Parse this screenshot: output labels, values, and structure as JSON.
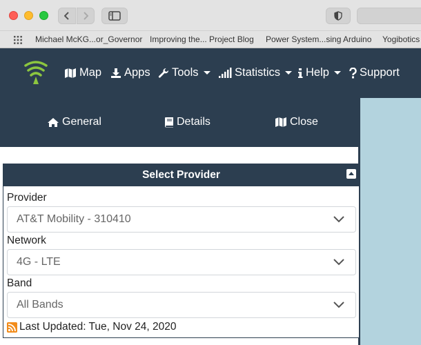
{
  "browser": {
    "bookmarks": [
      "Michael McKG...or_Governor",
      "Improving the... Project Blog",
      "Power System...sing Arduino",
      "Yogibotics"
    ]
  },
  "header": {
    "menu": [
      {
        "label": "Map",
        "icon": "map-icon"
      },
      {
        "label": "Apps",
        "icon": "download-icon"
      },
      {
        "label": "Tools",
        "icon": "wrench-icon"
      },
      {
        "label": "Statistics",
        "icon": "signal-bars-icon"
      },
      {
        "label": "Help",
        "icon": "info-icon"
      },
      {
        "label": "Support",
        "icon": "question-icon"
      }
    ]
  },
  "subnav": {
    "items": [
      {
        "label": "General",
        "icon": "home-icon"
      },
      {
        "label": "Details",
        "icon": "book-icon"
      },
      {
        "label": "Close",
        "icon": "map-icon"
      }
    ]
  },
  "panel": {
    "title": "Select Provider",
    "provider_label": "Provider",
    "provider_value": "AT&T Mobility - 310410",
    "network_label": "Network",
    "network_value": "4G - LTE",
    "band_label": "Band",
    "band_value": "All Bands",
    "last_updated": "Last Updated: Tue, Nov 24, 2020"
  },
  "colors": {
    "header_bg": "#2c3e50",
    "logo_green": "#8cc63f",
    "map_bg": "#b3d3de"
  }
}
